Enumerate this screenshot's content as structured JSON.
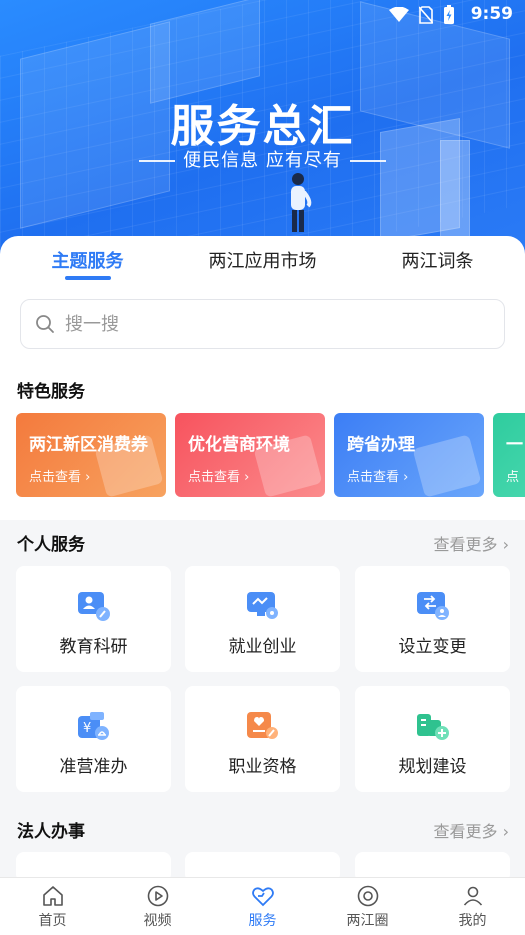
{
  "status": {
    "time": "9:59"
  },
  "hero": {
    "title": "服务总汇",
    "subtitle": "便民信息 应有尽有"
  },
  "tabs": [
    {
      "label": "主题服务",
      "active": true
    },
    {
      "label": "两江应用市场",
      "active": false
    },
    {
      "label": "两江词条",
      "active": false
    }
  ],
  "search": {
    "placeholder": "搜一搜"
  },
  "featured": {
    "title": "特色服务",
    "cards": [
      {
        "title": "两江新区消费券",
        "sub": "点击查看 ›",
        "color": "#f5894a"
      },
      {
        "title": "优化营商环境",
        "sub": "点击查看 ›",
        "color": "#f8636f"
      },
      {
        "title": "跨省办理",
        "sub": "点击查看 ›",
        "color": "#4b8ef6"
      },
      {
        "title": "一",
        "sub": "点",
        "color": "#35d1a6"
      }
    ]
  },
  "personal": {
    "title": "个人服务",
    "more": "查看更多 ›",
    "items": [
      {
        "label": "教育科研",
        "icon": "education-icon"
      },
      {
        "label": "就业创业",
        "icon": "employment-icon"
      },
      {
        "label": "设立变更",
        "icon": "registration-change-icon"
      },
      {
        "label": "准营准办",
        "icon": "business-permit-icon"
      },
      {
        "label": "职业资格",
        "icon": "qualification-icon"
      },
      {
        "label": "规划建设",
        "icon": "planning-construction-icon"
      }
    ]
  },
  "legal": {
    "title": "法人办事",
    "more": "查看更多 ›"
  },
  "nav": [
    {
      "label": "首页",
      "icon": "home-icon"
    },
    {
      "label": "视频",
      "icon": "video-icon"
    },
    {
      "label": "服务",
      "icon": "service-heart-icon",
      "active": true
    },
    {
      "label": "两江圈",
      "icon": "circle-chat-icon"
    },
    {
      "label": "我的",
      "icon": "profile-icon"
    }
  ],
  "colors": {
    "accent": "#2f7bf5",
    "hero": "#1f6ff0"
  }
}
